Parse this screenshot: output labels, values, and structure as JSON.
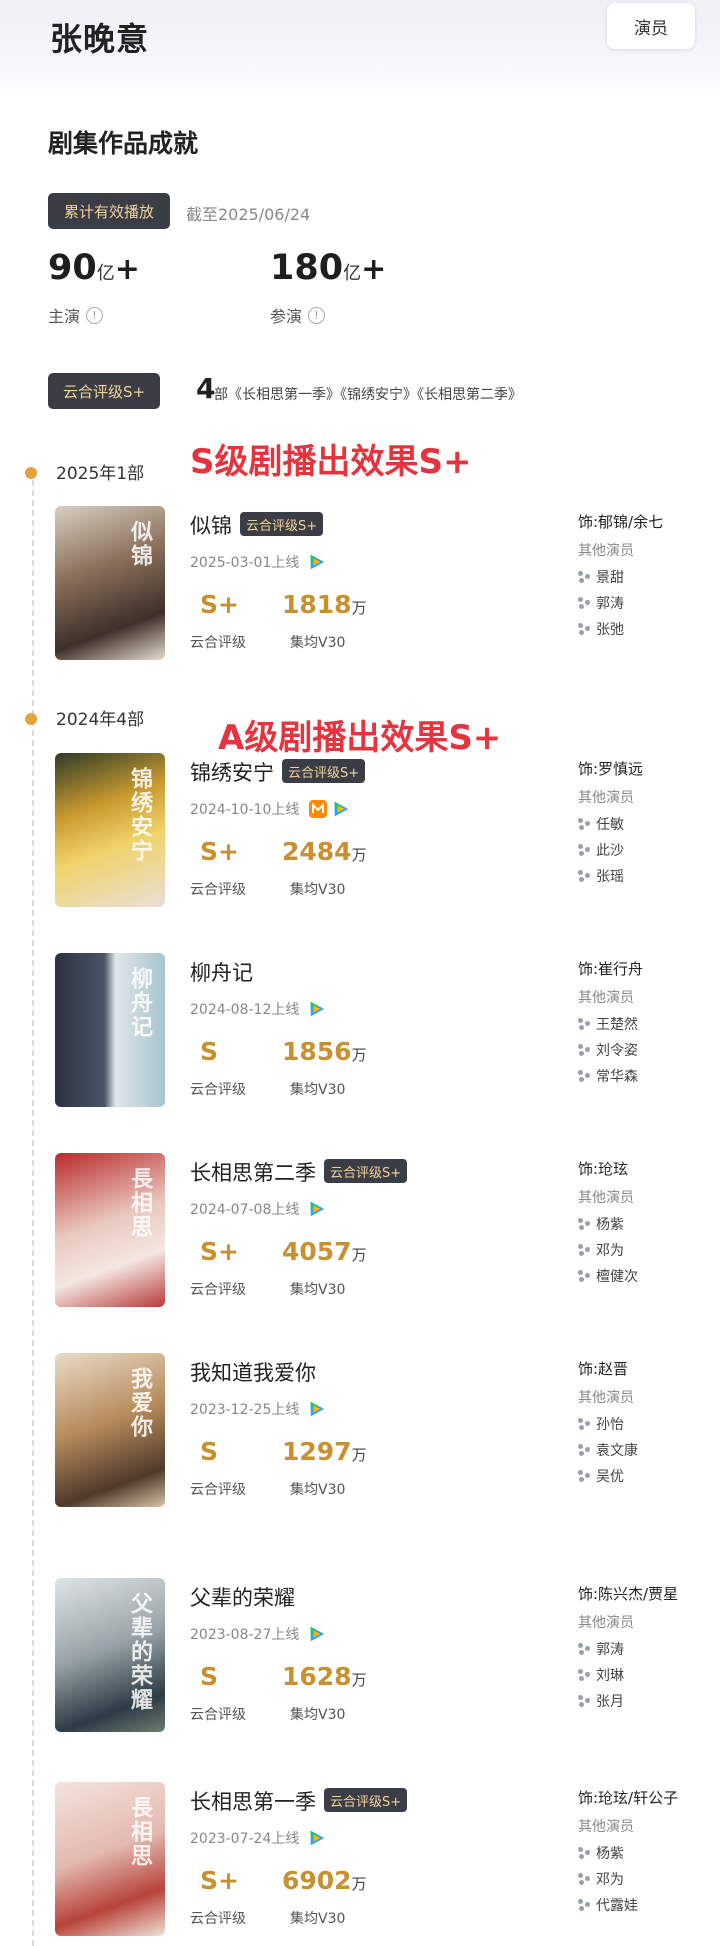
{
  "header": {
    "name": "张晚意",
    "role_button": "演员"
  },
  "section_title": "剧集作品成就",
  "play_tag": "累计有效播放",
  "as_of": "截至2025/06/24",
  "stats": [
    {
      "value": "90",
      "unit": "亿",
      "plus": "+",
      "label": "主演"
    },
    {
      "value": "180",
      "unit": "亿",
      "plus": "+",
      "label": "参演"
    }
  ],
  "rating_summary": {
    "tag": "云合评级S+",
    "count": "4",
    "unit": "部",
    "titles": "《长相思第一季》《锦绣安宁》《长相思第二季》"
  },
  "years": [
    {
      "label": "2025年1部",
      "annotation": "S级剧播出效果S+"
    },
    {
      "label": "2024年4部",
      "annotation": "A级剧播出效果S+"
    }
  ],
  "labels": {
    "grade_label": "云合评级",
    "avg_label": "集均V30",
    "others_label": "其他演员",
    "unit_wan": "万"
  },
  "dramas": [
    {
      "title": "似锦",
      "tag": "云合评级S+",
      "date": "2025-03-01上线",
      "platforms": [
        "tencent-icon"
      ],
      "grade": "S+",
      "avg": "1818",
      "role": "饰:郁锦/余七",
      "actors": [
        "景甜",
        "郭涛",
        "张弛"
      ],
      "poster_text": "似锦"
    },
    {
      "title": "锦绣安宁",
      "tag": "云合评级S+",
      "date": "2024-10-10上线",
      "platforms": [
        "mango-icon",
        "tencent-icon"
      ],
      "grade": "S+",
      "avg": "2484",
      "role": "饰:罗慎远",
      "actors": [
        "任敏",
        "此沙",
        "张瑶"
      ],
      "poster_text": "锦绣安宁"
    },
    {
      "title": "柳舟记",
      "tag": "",
      "date": "2024-08-12上线",
      "platforms": [
        "tencent-icon"
      ],
      "grade": "S",
      "avg": "1856",
      "role": "饰:崔行舟",
      "actors": [
        "王楚然",
        "刘令姿",
        "常华森"
      ],
      "poster_text": "柳舟记"
    },
    {
      "title": "长相思第二季",
      "tag": "云合评级S+",
      "date": "2024-07-08上线",
      "platforms": [
        "tencent-icon"
      ],
      "grade": "S+",
      "avg": "4057",
      "role": "饰:玱玹",
      "actors": [
        "杨紫",
        "邓为",
        "檀健次"
      ],
      "poster_text": "長相思"
    },
    {
      "title": "我知道我爱你",
      "tag": "",
      "date": "2023-12-25上线",
      "platforms": [
        "tencent-icon"
      ],
      "grade": "S",
      "avg": "1297",
      "role": "饰:赵晋",
      "actors": [
        "孙怡",
        "袁文康",
        "吴优"
      ],
      "poster_text": "我爱你"
    },
    {
      "title": "父辈的荣耀",
      "tag": "",
      "date": "2023-08-27上线",
      "platforms": [
        "tencent-icon"
      ],
      "grade": "S",
      "avg": "1628",
      "role": "饰:陈兴杰/贾星",
      "actors": [
        "郭涛",
        "刘琳",
        "张月"
      ],
      "poster_text": "父辈的荣耀"
    },
    {
      "title": "长相思第一季",
      "tag": "云合评级S+",
      "date": "2023-07-24上线",
      "platforms": [
        "tencent-icon"
      ],
      "grade": "S+",
      "avg": "6902",
      "role": "饰:玱玹/轩公子",
      "actors": [
        "杨紫",
        "邓为",
        "代露娃"
      ],
      "poster_text": "長相思"
    }
  ],
  "colors": {
    "gold": "#c8902e",
    "tag_bg": "#3a3d46",
    "tag_text": "#f1d39a",
    "annotation_red": "#e5343d",
    "dot": "#e5a13b"
  }
}
